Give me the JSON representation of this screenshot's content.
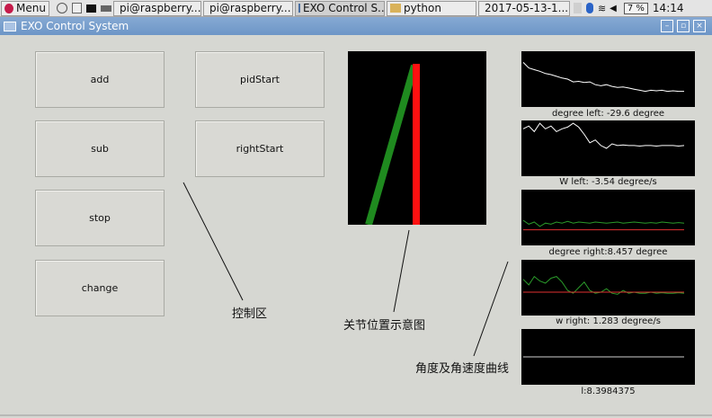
{
  "taskbar": {
    "menu_label": "Menu",
    "tasks": [
      {
        "label": "pi@raspberry..."
      },
      {
        "label": "pi@raspberry..."
      },
      {
        "label": "EXO Control S..."
      },
      {
        "label": "python"
      },
      {
        "label": "2017-05-13-1..."
      }
    ],
    "battery": "7 %",
    "clock": "14:14"
  },
  "window": {
    "title": "EXO Control System",
    "min_label": "–",
    "max_label": "▫",
    "close_label": "×"
  },
  "buttons": {
    "add": "add",
    "sub": "sub",
    "stop": "stop",
    "change": "change",
    "pid_start": "pidStart",
    "right_start": "rightStart"
  },
  "plots": [
    {
      "caption": "degree left:  -29.6  degree",
      "series": [
        {
          "color": "#ffffff",
          "values": [
            0.2,
            0.3,
            0.33,
            0.36,
            0.4,
            0.42,
            0.45,
            0.48,
            0.5,
            0.55,
            0.54,
            0.56,
            0.55,
            0.6,
            0.62,
            0.6,
            0.63,
            0.65,
            0.64,
            0.66,
            0.68,
            0.7,
            0.72,
            0.7,
            0.71,
            0.7,
            0.72,
            0.71,
            0.72,
            0.72
          ]
        }
      ]
    },
    {
      "caption": "W left:  -3.54  degree/s",
      "series": [
        {
          "color": "#ffffff",
          "values": [
            0.15,
            0.1,
            0.2,
            0.05,
            0.15,
            0.1,
            0.2,
            0.15,
            0.12,
            0.05,
            0.12,
            0.25,
            0.4,
            0.35,
            0.45,
            0.5,
            0.42,
            0.45,
            0.44,
            0.45,
            0.45,
            0.46,
            0.45,
            0.45,
            0.46,
            0.45,
            0.45,
            0.45,
            0.46,
            0.45
          ]
        }
      ]
    },
    {
      "caption": "degree right:8.457  degree",
      "series": [
        {
          "color": "#2a9a2a",
          "values": [
            0.55,
            0.62,
            0.58,
            0.66,
            0.6,
            0.62,
            0.58,
            0.6,
            0.57,
            0.6,
            0.58,
            0.59,
            0.6,
            0.58,
            0.59,
            0.6,
            0.59,
            0.58,
            0.6,
            0.59,
            0.58,
            0.59,
            0.6,
            0.59,
            0.6,
            0.58,
            0.59,
            0.6,
            0.59,
            0.6
          ]
        },
        {
          "color": "#e03030",
          "values": [
            0.72,
            0.72,
            0.72,
            0.72,
            0.72,
            0.72,
            0.72,
            0.72,
            0.72,
            0.72,
            0.72,
            0.72,
            0.72,
            0.72,
            0.72,
            0.72,
            0.72,
            0.72,
            0.72,
            0.72,
            0.72,
            0.72,
            0.72,
            0.72,
            0.72,
            0.72,
            0.72,
            0.72,
            0.72,
            0.72
          ]
        }
      ]
    },
    {
      "caption": "w right:  1.283  degree/s",
      "series": [
        {
          "color": "#2a9a2a",
          "values": [
            0.35,
            0.45,
            0.3,
            0.38,
            0.42,
            0.33,
            0.3,
            0.4,
            0.55,
            0.6,
            0.5,
            0.4,
            0.55,
            0.6,
            0.58,
            0.52,
            0.6,
            0.62,
            0.55,
            0.6,
            0.58,
            0.6,
            0.6,
            0.58,
            0.6,
            0.59,
            0.6,
            0.6,
            0.59,
            0.6
          ]
        },
        {
          "color": "#e03030",
          "values": [
            0.58,
            0.58,
            0.58,
            0.58,
            0.58,
            0.58,
            0.58,
            0.58,
            0.58,
            0.58,
            0.58,
            0.58,
            0.58,
            0.58,
            0.58,
            0.58,
            0.58,
            0.58,
            0.58,
            0.58,
            0.58,
            0.58,
            0.58,
            0.58,
            0.58,
            0.58,
            0.58,
            0.58,
            0.58,
            0.58
          ]
        }
      ]
    },
    {
      "caption": "l:8.3984375",
      "series": [
        {
          "color": "#cfcfcf",
          "values": [
            0.5,
            0.5,
            0.5,
            0.5,
            0.5,
            0.5,
            0.5,
            0.5,
            0.5,
            0.5,
            0.5,
            0.5,
            0.5,
            0.5,
            0.5,
            0.5,
            0.5,
            0.5,
            0.5,
            0.5,
            0.5,
            0.5,
            0.5,
            0.5,
            0.5,
            0.5,
            0.5,
            0.5,
            0.5,
            0.5
          ]
        }
      ]
    }
  ],
  "annotations": {
    "control_area": "控制区",
    "joint_position": "关节位置示意图",
    "angle_velocity": "角度及角速度曲线"
  },
  "colors": {
    "leg_left": "#1f8a1f",
    "leg_right": "#ff1010"
  }
}
